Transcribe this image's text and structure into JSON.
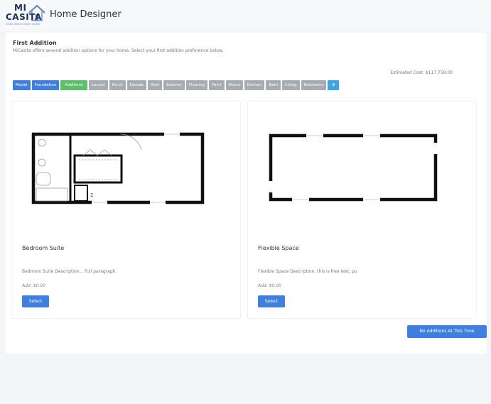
{
  "header": {
    "logo_mi": "MI",
    "logo_casita": "CASITA",
    "logo_tagline": "Home dreams made livable",
    "app_title": "Home Designer"
  },
  "section": {
    "title": "First Addition",
    "description": "MiCasita offers several addition options for your home. Select your first addition preference below."
  },
  "estimated_cost": "Estimated Cost: $117,759.00",
  "tabs": [
    {
      "label": "Model",
      "state": "done"
    },
    {
      "label": "Foundation",
      "state": "done"
    },
    {
      "label": "Additions",
      "state": "active"
    },
    {
      "label": "Layout",
      "state": "pending"
    },
    {
      "label": "Porch",
      "state": "pending"
    },
    {
      "label": "Facade",
      "state": "pending"
    },
    {
      "label": "Roof",
      "state": "pending"
    },
    {
      "label": "Exterior",
      "state": "pending"
    },
    {
      "label": "Flooring",
      "state": "pending"
    },
    {
      "label": "Paint",
      "state": "pending"
    },
    {
      "label": "Doors",
      "state": "pending"
    },
    {
      "label": "Kitchen",
      "state": "pending"
    },
    {
      "label": "Bath",
      "state": "pending"
    },
    {
      "label": "Living",
      "state": "pending"
    },
    {
      "label": "Bedrooms",
      "state": "pending"
    },
    {
      "label": "⚙",
      "state": "icon"
    }
  ],
  "options": [
    {
      "title": "Bedroom Suite",
      "description": "Bedroom Suite Description... Full paragraph.",
      "price": "Add: $0.00",
      "button": "Select"
    },
    {
      "title": "Flexible Space",
      "description": "Flexible Space Description. this is free text, pu",
      "price": "Add: $0.00",
      "button": "Select"
    }
  ],
  "no_additions_button": "No Additions At This Time",
  "colors": {
    "primary": "#3f7fe0",
    "active_tab": "#5cbf6a",
    "pending_tab": "#a7abb2",
    "settings_tab": "#3ea4e6",
    "logo": "#1e2d5a"
  }
}
